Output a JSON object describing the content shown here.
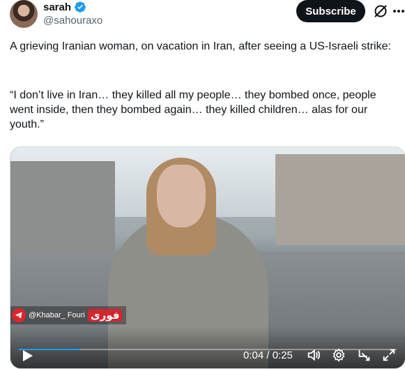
{
  "author": {
    "name": "sarah",
    "handle": "@sahouraxo",
    "verified": true
  },
  "actions": {
    "subscribe_label": "Subscribe",
    "grok_icon": "grok-slash-icon",
    "more_icon": "more-icon"
  },
  "tweet": {
    "line1": "A grieving Iranian woman, on vacation in Iran, after seeing a US-Israeli strike:",
    "quote": "“I don’t live in Iran… they killed all my people… they bombed once, people went inside, then they bombed again… they killed children… alas for our youth.”"
  },
  "video": {
    "watermark_handle": "@Khabar_ Fouri",
    "watermark_logo": "فوری",
    "time_display": "0:04 / 0:25",
    "progress_fraction": 0.16,
    "icons": [
      "play-icon",
      "volume-icon",
      "settings-icon",
      "fullscreen-exit-icon",
      "expand-icon"
    ]
  },
  "colors": {
    "text": "#0f1419",
    "muted": "#536471",
    "verified": "#1d9bf0",
    "subscribe_bg": "#0f1419"
  }
}
